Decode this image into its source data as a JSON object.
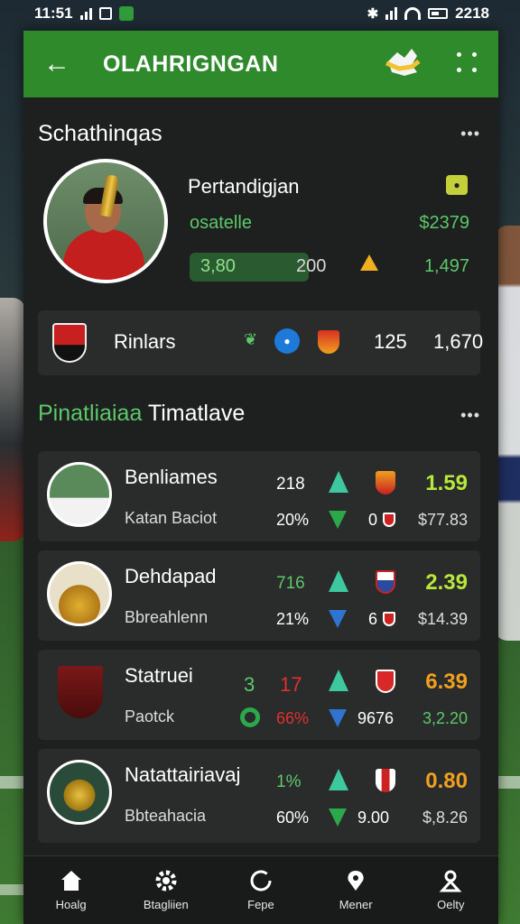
{
  "status": {
    "time": "11:51",
    "right_time": "2218"
  },
  "app": {
    "title": "OLAHRIGNGAN",
    "back": "←"
  },
  "colors": {
    "accent": "#2f8a2c",
    "positive": "#5cc86a",
    "price_yellow": "#b8e83a",
    "price_orange": "#f0a020",
    "down_red": "#e03030"
  },
  "featured": {
    "section_title": "Schathinqas",
    "more": "•••",
    "name": "Pertandigjan",
    "team": "osatelle",
    "price": "$2379",
    "pill_text": "3,80",
    "pill_num": "200",
    "right_value": "1,497",
    "team_row": {
      "name": "Rinlars",
      "n1": "125",
      "n2": "1,670"
    }
  },
  "list_section": {
    "title_green": "Pinatliaiaa",
    "title_white": "Timatlave",
    "more": "•••"
  },
  "rows": [
    {
      "name": "Benliames",
      "sub": "Katan Baciot",
      "v1": "218",
      "v2": "20%",
      "n3": "0",
      "price": "1.59",
      "p2": "$77.83",
      "price_color": "#b8e83a"
    },
    {
      "name": "Dehdapad",
      "sub": "Bbreahlenn",
      "v1": "716",
      "v2": "21%",
      "n3": "6",
      "price": "2.39",
      "p2": "$14.39",
      "price_color": "#b8e83a"
    },
    {
      "name": "Statruei",
      "sub": "Paotck",
      "v1": "3",
      "v1b": "17",
      "v2": "66%",
      "n3": "9676",
      "price": "6.39",
      "p2": "3,2.20",
      "price_color": "#f0a020"
    },
    {
      "name": "Natattairiavaj",
      "sub": "Bbteahacia",
      "v1": "1%",
      "v2": "60%",
      "n3": "9.00",
      "price": "0.80",
      "p2": "$,8.26",
      "price_color": "#f0a020"
    }
  ],
  "nav": [
    {
      "label": "Hoalg",
      "icon": "home-icon"
    },
    {
      "label": "Btagliien",
      "icon": "gear-icon"
    },
    {
      "label": "Fepe",
      "icon": "refresh-icon"
    },
    {
      "label": "Mener",
      "icon": "pin-icon"
    },
    {
      "label": "Oelty",
      "icon": "person-icon"
    }
  ]
}
